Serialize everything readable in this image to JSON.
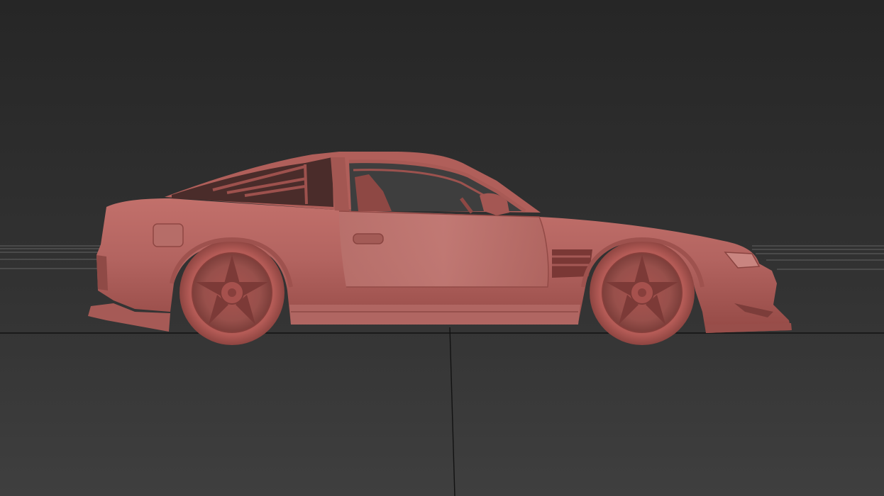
{
  "viewport": {
    "background_top": "#282828",
    "background_bottom": "#3c3c3c",
    "grid_line_color": "#151515",
    "grid_far_color": "#8a8a8a"
  },
  "model": {
    "subject": "car-side-view",
    "body_color": "#b8625e",
    "body_shadow": "#7d3a37",
    "body_highlight": "#cf8580",
    "glass_color": "#3a2624",
    "wheel_color": "#9c4d49"
  }
}
